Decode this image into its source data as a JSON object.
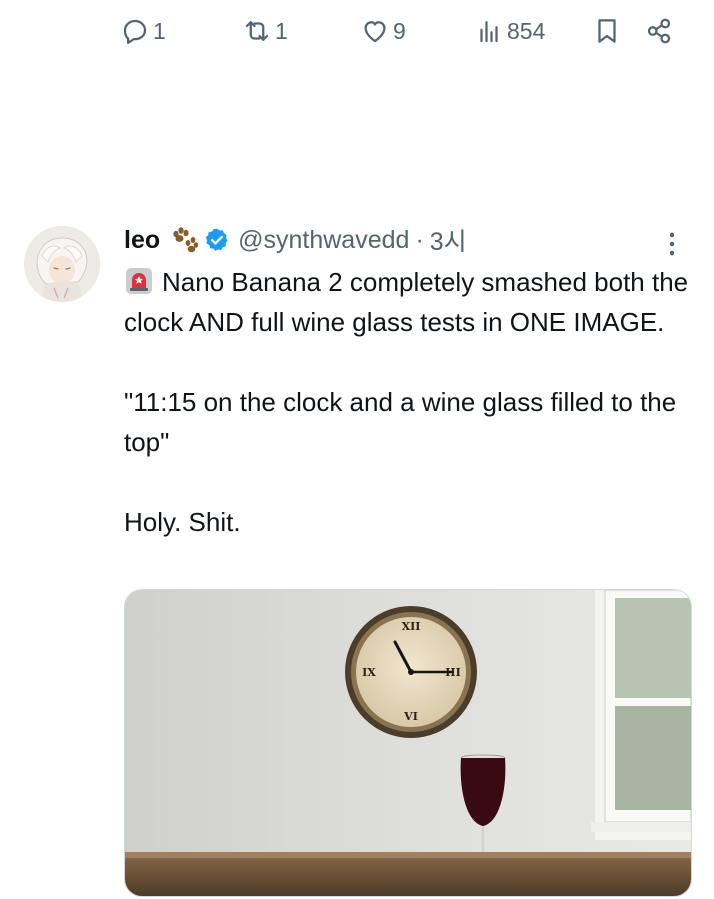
{
  "actions": {
    "reply_count": "1",
    "repost_count": "1",
    "like_count": "9",
    "view_count": "854"
  },
  "tweet": {
    "author_name": "leo",
    "handle": "@synthwavedd",
    "separator": "·",
    "time": "3시",
    "text_line1": "Nano Banana 2 completely smashed both the clock AND full wine glass tests in ONE IMAGE.",
    "text_quote": "\"11:15 on the clock and a wine glass filled to the top\"",
    "text_final": "Holy. Shit."
  },
  "icons": {
    "reply": "reply-icon",
    "repost": "repost-icon",
    "like": "heart-icon",
    "views": "views-chart-icon",
    "bookmark": "bookmark-icon",
    "share": "share-icon",
    "verified": "verified-badge-icon",
    "paw": "paw-emoji",
    "siren": "siren-emoji",
    "more": "more-vertical-icon"
  },
  "colors": {
    "verified_blue": "#1d9bf0",
    "muted_gray": "#536471",
    "wine": "#4a0f18"
  }
}
